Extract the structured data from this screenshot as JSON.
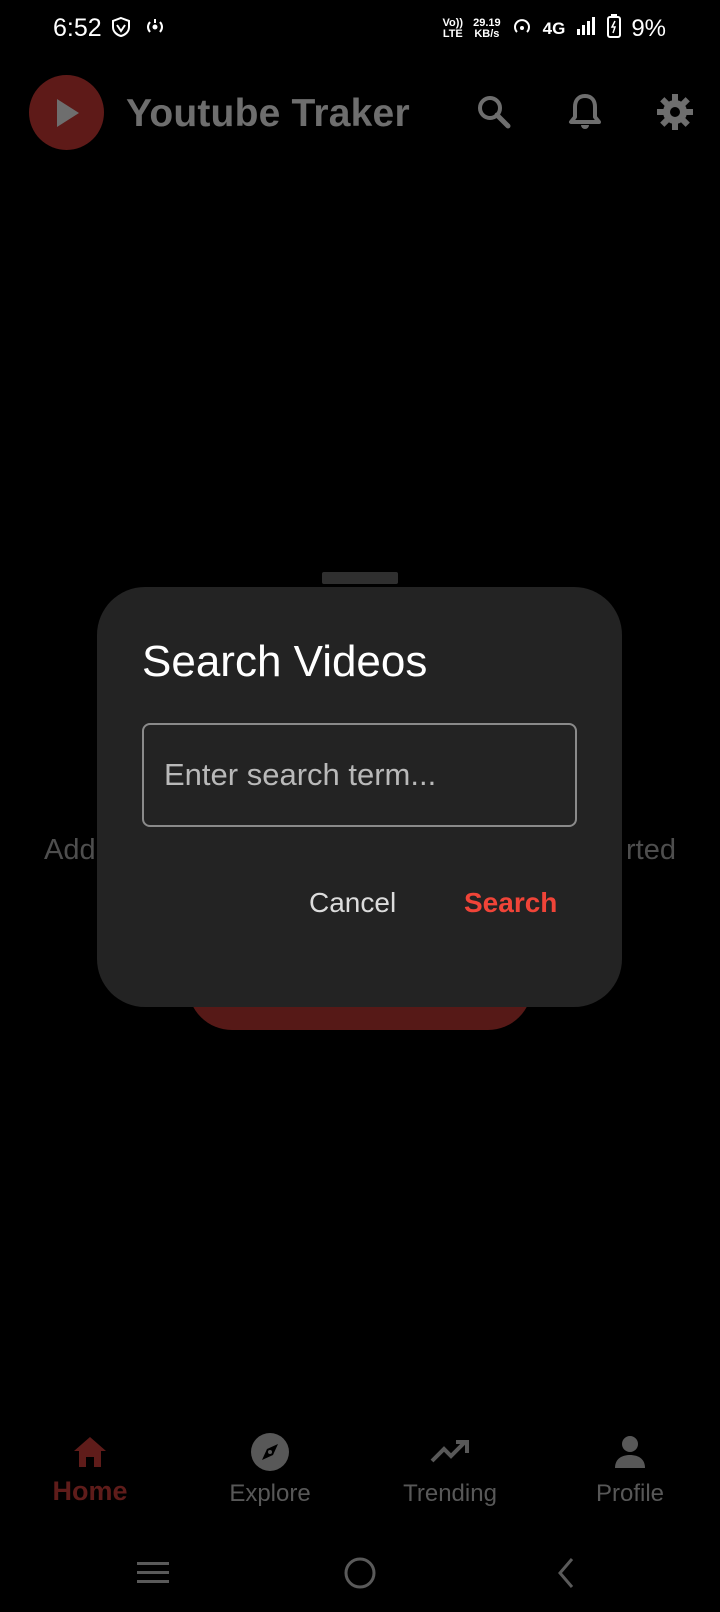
{
  "status_bar": {
    "time": "6:52",
    "volte_top": "Vo))",
    "volte_bottom": "LTE",
    "speed_value": "29.19",
    "speed_unit": "KB/s",
    "network": "4G",
    "battery": "9%"
  },
  "app_bar": {
    "title": "Youtube Traker",
    "icons": [
      "search-icon",
      "bell-icon",
      "gear-icon"
    ]
  },
  "background": {
    "text_left": "Add",
    "text_right": "rted"
  },
  "dialog": {
    "title": "Search Videos",
    "input_placeholder": "Enter search term...",
    "input_value": "",
    "cancel_label": "Cancel",
    "search_label": "Search"
  },
  "bottom_nav": {
    "items": [
      {
        "label": "Home",
        "icon": "home-icon",
        "active": true
      },
      {
        "label": "Explore",
        "icon": "compass-icon",
        "active": false
      },
      {
        "label": "Trending",
        "icon": "trending-icon",
        "active": false
      },
      {
        "label": "Profile",
        "icon": "person-icon",
        "active": false
      }
    ]
  },
  "colors": {
    "accent": "#f04438",
    "dialog_bg": "#232323",
    "scrim_bg": "#000000"
  }
}
